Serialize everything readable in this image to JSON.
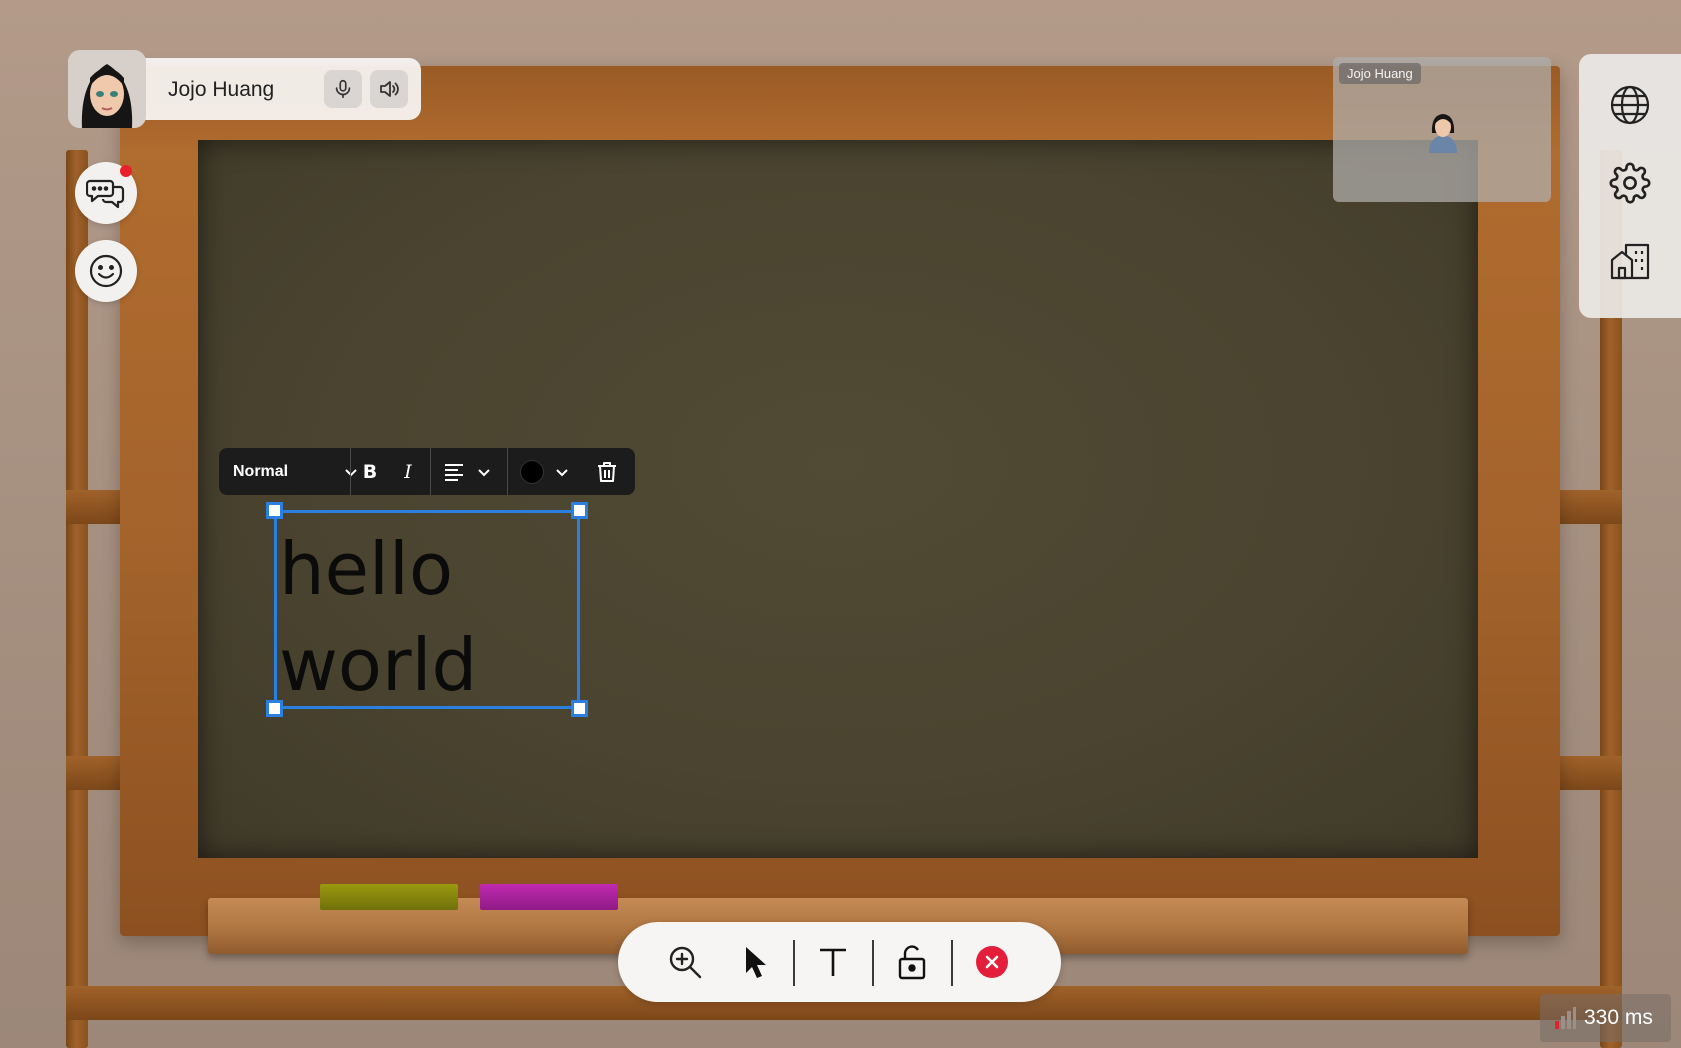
{
  "user": {
    "name": "Jojo Huang",
    "mic_icon": "microphone-icon",
    "speaker_icon": "speaker-icon"
  },
  "left_buttons": [
    {
      "icon": "chat-icon",
      "has_notification": true
    },
    {
      "icon": "emoji-icon"
    }
  ],
  "right_panel": {
    "icons": [
      "globe-icon",
      "gear-icon",
      "building-icon"
    ]
  },
  "video_preview": {
    "label": "Jojo Huang"
  },
  "format_toolbar": {
    "style_label": "Normal",
    "bold_label": "B",
    "italic_label": "I",
    "color": "#000000"
  },
  "text_box": {
    "content": "hello\nworld",
    "selection_color": "#2b7fe0"
  },
  "bottom_toolbar": {
    "tools": [
      "zoom-in-icon",
      "pointer-icon",
      "text-icon",
      "unlock-icon",
      "close-icon"
    ],
    "close_color": "#e41e3a"
  },
  "latency": {
    "value": "330 ms"
  }
}
